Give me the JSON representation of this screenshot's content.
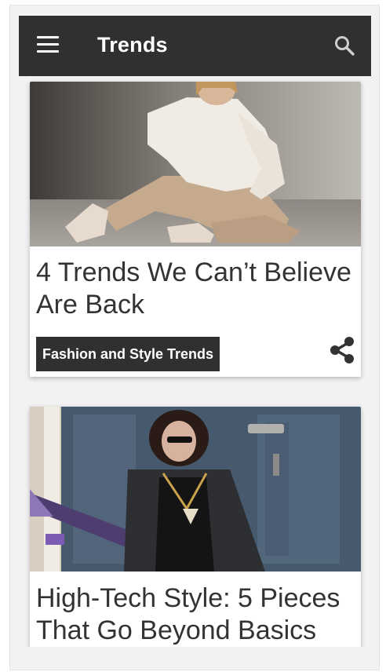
{
  "appbar": {
    "title": "Trends",
    "menu_icon": "hamburger-menu-icon",
    "search_icon": "search-icon"
  },
  "articles": [
    {
      "title": "4 Trends We Can’t Believe Are Back",
      "category": "Fashion and Style Trends",
      "share_icon": "share-icon"
    },
    {
      "title": "High-Tech Style: 5 Pieces That Go Beyond Basics"
    }
  ],
  "colors": {
    "appbar_bg": "#303030",
    "background": "#f2f2f2",
    "card_bg": "#ffffff",
    "tag_bg": "#303030",
    "title_text": "#333333"
  }
}
